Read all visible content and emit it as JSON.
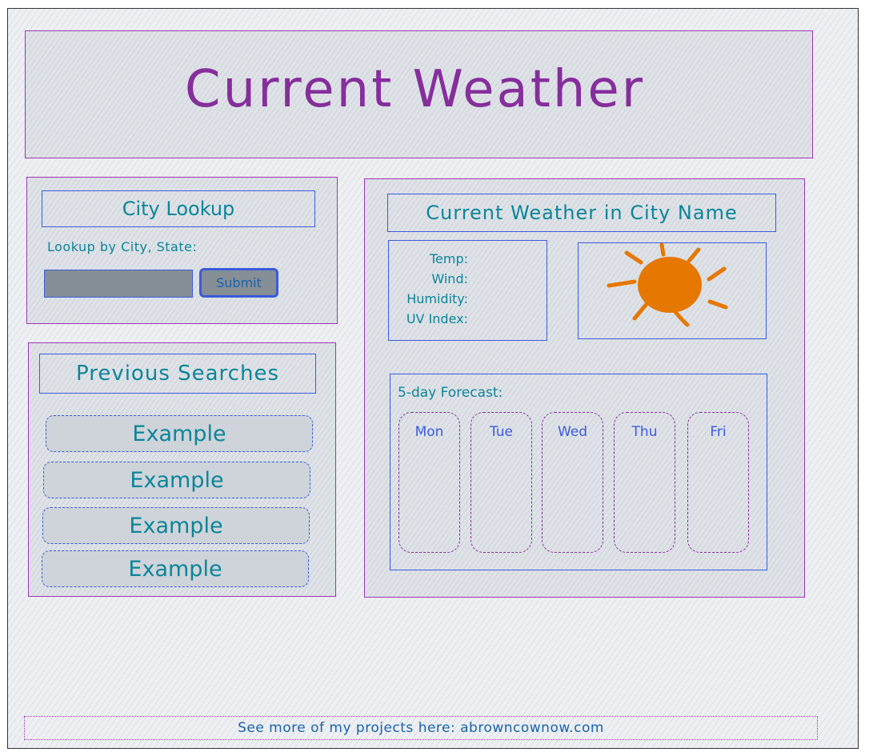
{
  "header": {
    "title": "Current Weather"
  },
  "city_lookup": {
    "title": "City Lookup",
    "label": "Lookup by City, State:",
    "input_value": "",
    "submit_label": "Submit"
  },
  "previous_searches": {
    "title": "Previous Searches",
    "items": [
      {
        "label": "Example"
      },
      {
        "label": "Example"
      },
      {
        "label": "Example"
      },
      {
        "label": "Example"
      }
    ]
  },
  "current_weather": {
    "title": "Current Weather in City Name",
    "stats": {
      "temp_label": "Temp:",
      "wind_label": "Wind:",
      "humidity_label": "Humidity:",
      "uv_label": "UV Index:"
    },
    "icon": "sun-icon",
    "icon_color": "#e67700"
  },
  "forecast": {
    "label": "5-day Forecast:",
    "days": [
      {
        "name": "Mon"
      },
      {
        "name": "Tue"
      },
      {
        "name": "Wed"
      },
      {
        "name": "Thu"
      },
      {
        "name": "Fri"
      }
    ]
  },
  "footer": {
    "text": "See more of my projects here: abrowncownow.com"
  },
  "colors": {
    "title_purple": "#862e9c",
    "panel_border_purple": "#9c36b5",
    "text_teal": "#0c8599",
    "border_blue": "#3b5bdb",
    "sun_orange": "#e67700"
  }
}
